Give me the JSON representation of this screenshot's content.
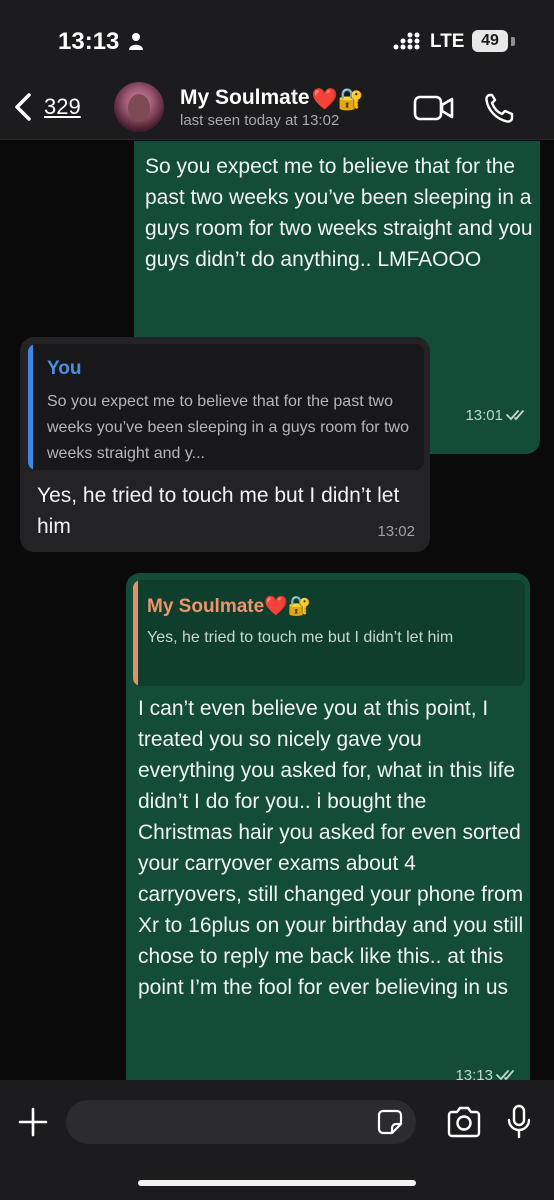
{
  "status_bar": {
    "time": "13:13",
    "network": "LTE",
    "battery": "49"
  },
  "header": {
    "back_count": "329",
    "contact_name": "My Soulmate",
    "contact_emoji": "❤️🔐",
    "last_seen": "last seen today at 13:02"
  },
  "messages": [
    {
      "direction": "outgoing",
      "text": "So you expect me to believe that for the past two weeks you’ve been sleeping in a guys room for two weeks straight and you guys didn’t do anything.. LMFAOOO",
      "time": "13:01",
      "status": "read"
    },
    {
      "direction": "incoming",
      "quote_author": "You",
      "quote_text": "So you expect me to believe that for the past two weeks you’ve been sleeping in a guys room for two weeks straight and y...",
      "text": "Yes, he tried to touch me but I didn’t let him",
      "time": "13:02"
    },
    {
      "direction": "outgoing",
      "quote_author": "My Soulmate",
      "quote_author_emoji": "❤️🔐",
      "quote_text": "Yes, he tried to touch me but I didn’t let him",
      "text": "I can’t even believe you at this point, I treated you so nicely gave you everything you asked for, what in this life didn’t I do for you.. i bought the Christmas hair you asked for even sorted your carryover exams about 4 carryovers, still changed your phone from Xr to 16plus on your birthday and you still chose to reply me back like this.. at this point I’m the fool for ever believing in us",
      "time": "13:13",
      "status": "read"
    }
  ],
  "composer": {
    "placeholder": ""
  },
  "colors": {
    "outgoing_bubble": "#134d37",
    "incoming_bubble": "#232325",
    "quote_you": "#4a90e2",
    "quote_contact": "#f0946a"
  },
  "icons": [
    "person-icon",
    "signal-icon",
    "back-chevron-icon",
    "video-call-icon",
    "phone-icon",
    "plus-icon",
    "sticker-icon",
    "camera-icon",
    "mic-icon",
    "read-ticks-icon"
  ]
}
